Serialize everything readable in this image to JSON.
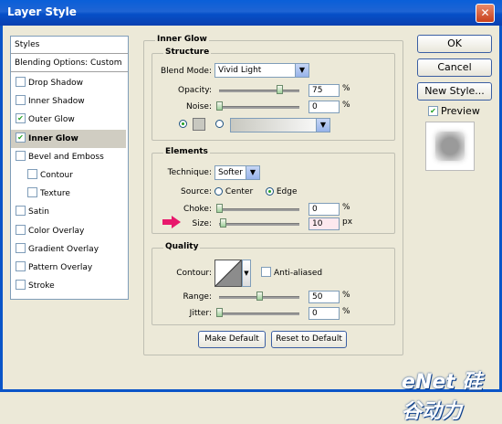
{
  "window": {
    "title": "Layer Style",
    "close_glyph": "✕"
  },
  "styles_panel": {
    "header": "Styles",
    "blending_options": "Blending Options: Custom",
    "items": [
      {
        "label": "Drop Shadow",
        "checked": false,
        "selected": false,
        "indent": false
      },
      {
        "label": "Inner Shadow",
        "checked": false,
        "selected": false,
        "indent": false
      },
      {
        "label": "Outer Glow",
        "checked": true,
        "selected": false,
        "indent": false
      },
      {
        "label": "Inner Glow",
        "checked": true,
        "selected": true,
        "indent": false
      },
      {
        "label": "Bevel and Emboss",
        "checked": false,
        "selected": false,
        "indent": false
      },
      {
        "label": "Contour",
        "checked": false,
        "selected": false,
        "indent": true
      },
      {
        "label": "Texture",
        "checked": false,
        "selected": false,
        "indent": true
      },
      {
        "label": "Satin",
        "checked": false,
        "selected": false,
        "indent": false
      },
      {
        "label": "Color Overlay",
        "checked": false,
        "selected": false,
        "indent": false
      },
      {
        "label": "Gradient Overlay",
        "checked": false,
        "selected": false,
        "indent": false
      },
      {
        "label": "Pattern Overlay",
        "checked": false,
        "selected": false,
        "indent": false
      },
      {
        "label": "Stroke",
        "checked": false,
        "selected": false,
        "indent": false
      }
    ]
  },
  "inner_glow": {
    "title": "Inner Glow",
    "structure": {
      "title": "Structure",
      "blend_mode_label": "Blend Mode:",
      "blend_mode_value": "Vivid Light",
      "opacity_label": "Opacity:",
      "opacity_value": "75",
      "opacity_fraction": 0.75,
      "noise_label": "Noise:",
      "noise_value": "0",
      "noise_fraction": 0,
      "unit": "%",
      "color_radio_selected": true,
      "gradient_radio_selected": false,
      "swatch_color": "#c8c8c0"
    },
    "elements": {
      "title": "Elements",
      "technique_label": "Technique:",
      "technique_value": "Softer",
      "source_label": "Source:",
      "source_center": "Center",
      "source_edge": "Edge",
      "source_selected": "Edge",
      "choke_label": "Choke:",
      "choke_value": "0",
      "choke_fraction": 0,
      "size_label": "Size:",
      "size_value": "10",
      "size_fraction": 0.04,
      "choke_unit": "%",
      "size_unit": "px"
    },
    "quality": {
      "title": "Quality",
      "contour_label": "Contour:",
      "anti_aliased_label": "Anti-aliased",
      "anti_aliased_checked": false,
      "range_label": "Range:",
      "range_value": "50",
      "range_fraction": 0.5,
      "jitter_label": "Jitter:",
      "jitter_value": "0",
      "jitter_fraction": 0,
      "unit": "%"
    },
    "make_default": "Make Default",
    "reset_default": "Reset to Default"
  },
  "buttons": {
    "ok": "OK",
    "cancel": "Cancel",
    "new_style": "New Style..."
  },
  "preview": {
    "label": "Preview",
    "checked": true
  },
  "watermark": "eNet 硅谷动力",
  "colors": {
    "accent_arrow": "#e8186c",
    "check_green": "#21a121",
    "title_blue": "#0a5fd8"
  }
}
